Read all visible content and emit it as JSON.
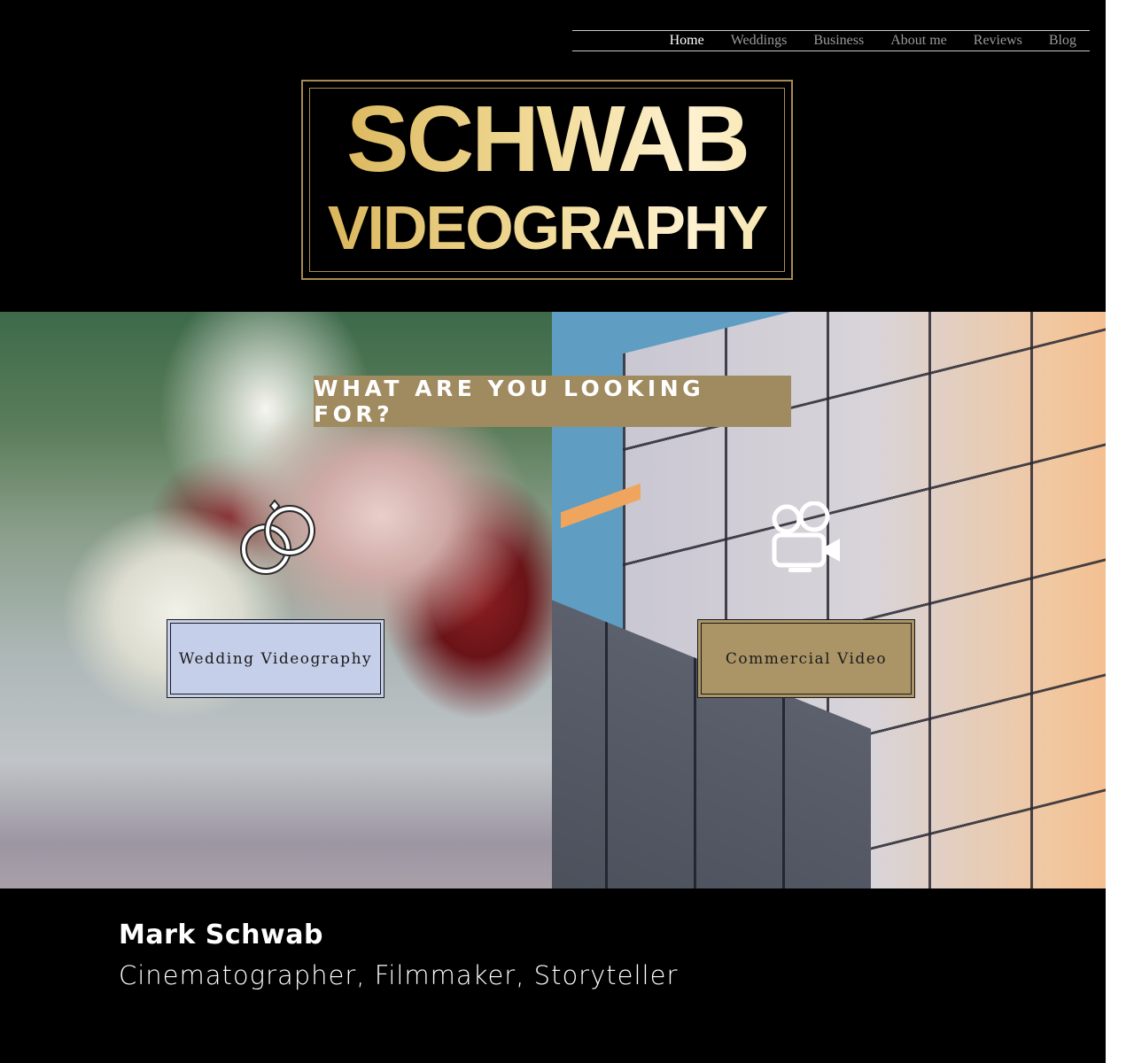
{
  "nav": {
    "items": [
      {
        "label": "Home",
        "active": true
      },
      {
        "label": "Weddings",
        "active": false
      },
      {
        "label": "Business",
        "active": false
      },
      {
        "label": "About me",
        "active": false
      },
      {
        "label": "Reviews",
        "active": false
      },
      {
        "label": "Blog",
        "active": false
      }
    ]
  },
  "logo": {
    "line1": "SCHWAB",
    "line2": "VIDEOGRAPHY",
    "colors": {
      "gold": "#d8b254",
      "gold_light": "#fdf1d0",
      "border": "#a88a4e"
    }
  },
  "hero": {
    "title": "WHAT ARE YOU LOOKING FOR?",
    "title_bg": "#a08b60",
    "wedding": {
      "icon": "wedding-rings-icon",
      "button_label": "Wedding Videography",
      "button_color": "#c6cfe9"
    },
    "commercial": {
      "icon": "movie-camera-icon",
      "button_label": "Commercial Video",
      "button_color": "#ab9466"
    }
  },
  "about": {
    "name": "Mark Schwab",
    "tagline": "Cinematographer, Filmmaker, Storyteller"
  }
}
